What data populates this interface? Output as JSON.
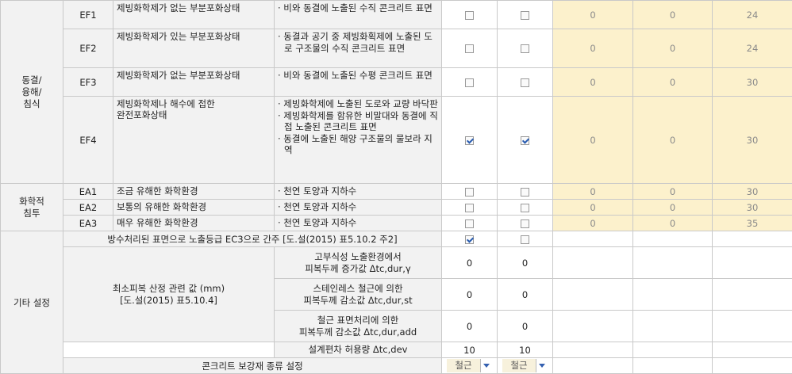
{
  "groups": {
    "freeze": "동결/\n융해/\n침식",
    "chem": "화학적\n침투",
    "other": "기타 설정"
  },
  "rows": [
    {
      "code": "EF1",
      "desc": "제빙화학제가 없는 부분포화상태",
      "env": [
        "· 비와 동결에 노출된 수직 콘크리트 표면"
      ],
      "cb1": false,
      "cb2": false,
      "v1": "0",
      "v2": "0",
      "v3": "24"
    },
    {
      "code": "EF2",
      "desc": "제빙화학제가 있는 부분포화상태",
      "env": [
        "· 동결과 공기 중 제빙화획제에 노출된 도로 구조물의 수직 콘크리트 표면"
      ],
      "cb1": false,
      "cb2": false,
      "v1": "0",
      "v2": "0",
      "v3": "24"
    },
    {
      "code": "EF3",
      "desc": "제빙화학제가 없는 부분포화상태",
      "env": [
        "· 비와 동결에 노출된 수평 콘크리트 표면"
      ],
      "cb1": false,
      "cb2": false,
      "v1": "0",
      "v2": "0",
      "v3": "30"
    },
    {
      "code": "EF4",
      "desc": "제빙화학제나 해수에 접한\n완전포화상태",
      "env": [
        "· 제빙화학제에 노출된 도로와 교량 바닥판",
        "· 제빙화학제를 함유한 비말대와 동결에 직접 노출된 콘크리트 표면",
        "· 동결에 노출된 해양 구조물의 물보라 지역"
      ],
      "cb1": true,
      "cb2": true,
      "v1": "0",
      "v2": "0",
      "v3": "30"
    },
    {
      "code": "EA1",
      "desc": "조금 유해한 화학환경",
      "env": [
        "· 천연 토양과 지하수"
      ],
      "cb1": false,
      "cb2": false,
      "v1": "0",
      "v2": "0",
      "v3": "30"
    },
    {
      "code": "EA2",
      "desc": "보통의 유해한 화학환경",
      "env": [
        "· 천연 토양과 지하수"
      ],
      "cb1": false,
      "cb2": false,
      "v1": "0",
      "v2": "0",
      "v3": "30"
    },
    {
      "code": "EA3",
      "desc": "매우 유해한 화학환경",
      "env": [
        "· 천연 토양과 지하수"
      ],
      "cb1": false,
      "cb2": false,
      "v1": "0",
      "v2": "0",
      "v3": "35"
    }
  ],
  "waterproof": {
    "label": "방수처리된 표면으로 노출등급 EC3으로 간주 [도.설(2015) 표5.10.2 주2]",
    "cb1": true,
    "cb2": false
  },
  "min_cover": {
    "label": "최소피복 산정 관련 값 (mm)\n[도.설(2015) 표5.10.4]",
    "items": [
      {
        "label": "고부식성 노출환경에서\n피복두께 증가값 Δtc,dur,γ",
        "v1": "0",
        "v2": "0"
      },
      {
        "label": "스테인레스 철근에 의한\n피복두께 감소값 Δtc,dur,st",
        "v1": "0",
        "v2": "0"
      },
      {
        "label": "철근 표면처리에 의한\n피복두께 감소값 Δtc,dur,add",
        "v1": "0",
        "v2": "0"
      }
    ],
    "tolerance": {
      "label": "설계편차 허용량 Δtc,dev",
      "v1": "10",
      "v2": "10"
    }
  },
  "rebar": {
    "label": "콘크리트 보강재 종류 설정",
    "sel1": "철근",
    "sel2": "철근"
  },
  "colors": {
    "highlight": "#fcf1cc",
    "header": "#f2f2f2",
    "check": "#2a5db0"
  }
}
